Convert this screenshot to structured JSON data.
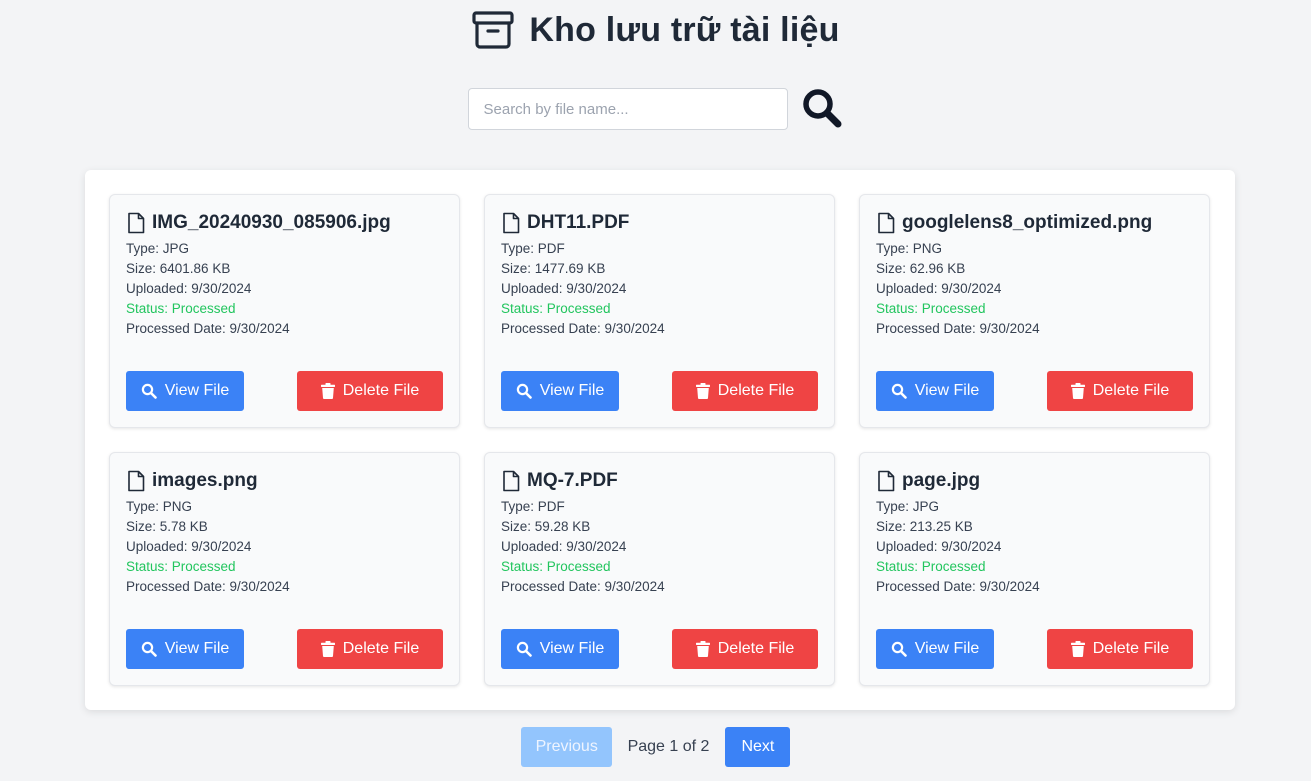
{
  "header": {
    "title": "Kho lưu trữ tài liệu",
    "icon": "archive-box-icon"
  },
  "search": {
    "placeholder": "Search by file name...",
    "value": "",
    "icon": "magnifying-glass-icon"
  },
  "colors": {
    "primary": "#3b82f6",
    "danger": "#ef4444",
    "status_ok": "#22c55e",
    "disabled": "#93c5fd"
  },
  "files": [
    {
      "name": "IMG_20240930_085906.jpg",
      "type": "Type: JPG",
      "size": "Size: 6401.86 KB",
      "uploaded": "Uploaded: 9/30/2024",
      "status": "Status: Processed",
      "processed": "Processed Date: 9/30/2024"
    },
    {
      "name": "DHT11.PDF",
      "type": "Type: PDF",
      "size": "Size: 1477.69 KB",
      "uploaded": "Uploaded: 9/30/2024",
      "status": "Status: Processed",
      "processed": "Processed Date: 9/30/2024"
    },
    {
      "name": "googlelens8_optimized.png",
      "type": "Type: PNG",
      "size": "Size: 62.96 KB",
      "uploaded": "Uploaded: 9/30/2024",
      "status": "Status: Processed",
      "processed": "Processed Date: 9/30/2024"
    },
    {
      "name": "images.png",
      "type": "Type: PNG",
      "size": "Size: 5.78 KB",
      "uploaded": "Uploaded: 9/30/2024",
      "status": "Status: Processed",
      "processed": "Processed Date: 9/30/2024"
    },
    {
      "name": "MQ-7.PDF",
      "type": "Type: PDF",
      "size": "Size: 59.28 KB",
      "uploaded": "Uploaded: 9/30/2024",
      "status": "Status: Processed",
      "processed": "Processed Date: 9/30/2024"
    },
    {
      "name": "page.jpg",
      "type": "Type: JPG",
      "size": "Size: 213.25 KB",
      "uploaded": "Uploaded: 9/30/2024",
      "status": "Status: Processed",
      "processed": "Processed Date: 9/30/2024"
    }
  ],
  "actions": {
    "view_label": "View File",
    "delete_label": "Delete File"
  },
  "pagination": {
    "previous_label": "Previous",
    "page_info": "Page 1 of 2",
    "next_label": "Next",
    "current_page": 1,
    "total_pages": 2
  }
}
